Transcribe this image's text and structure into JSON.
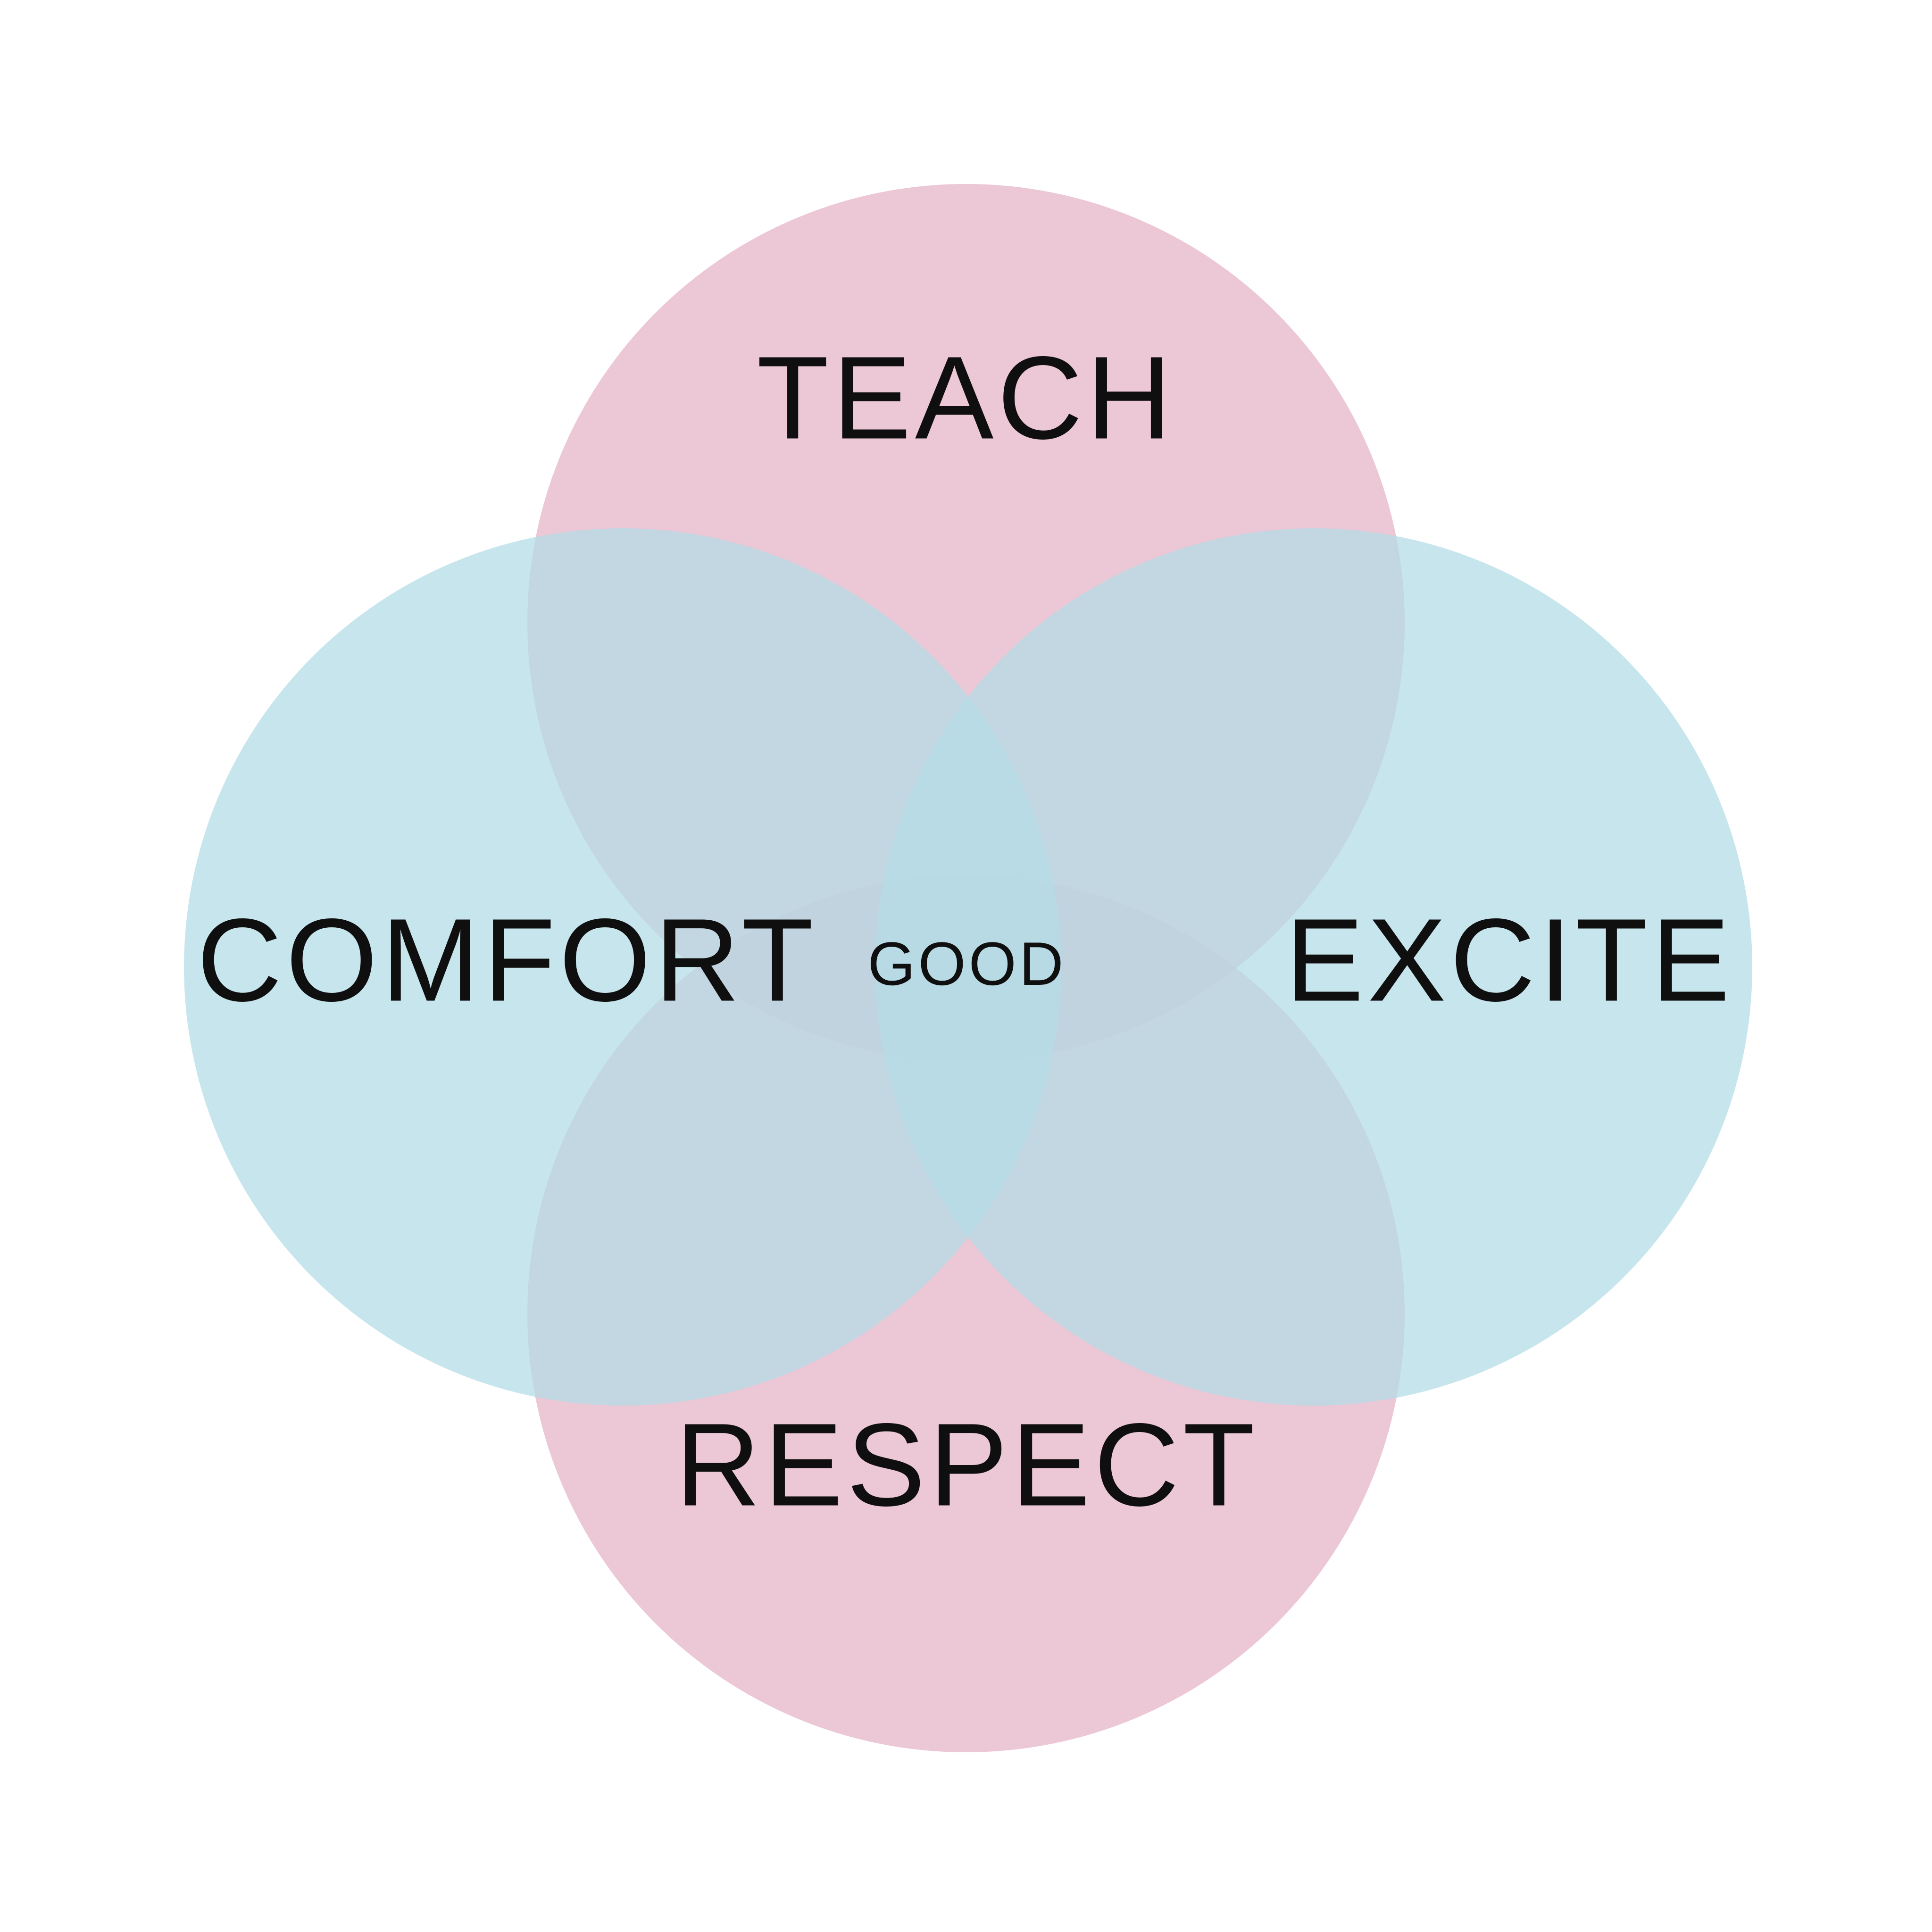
{
  "diagram": {
    "type": "venn",
    "sets": [
      {
        "id": "teach",
        "label": "TEACH",
        "color": "#e6b4c8"
      },
      {
        "id": "comfort",
        "label": "COMFORT",
        "color": "#b4dce6"
      },
      {
        "id": "excite",
        "label": "EXCITE",
        "color": "#b4dce6"
      },
      {
        "id": "respect",
        "label": "RESPECT",
        "color": "#e6b4c8"
      }
    ],
    "center": {
      "label": "GOOD"
    }
  }
}
